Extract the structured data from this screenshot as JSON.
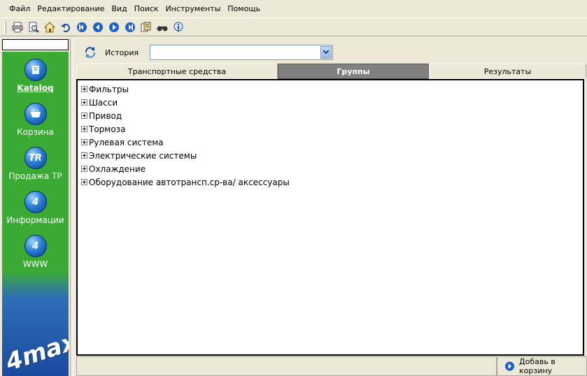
{
  "menu": [
    "Файл",
    "Редактирование",
    "Вид",
    "Поиск",
    "Инструменты",
    "Помощь"
  ],
  "toolbar": {
    "icons": [
      "print-icon",
      "preview-icon",
      "home-icon",
      "undo-icon",
      "first-icon",
      "back-icon",
      "forward-icon",
      "last-icon",
      "documents-icon",
      "binoculars-icon",
      "info-icon"
    ]
  },
  "sidebar": {
    "items": [
      {
        "label": "Kataloq",
        "icon": "catalog-icon",
        "glyph": "",
        "active": true
      },
      {
        "label": "Корзина",
        "icon": "basket-icon",
        "glyph": "",
        "active": false
      },
      {
        "label": "Продажа ТР",
        "icon": "tr-icon",
        "glyph": "TR",
        "active": false
      },
      {
        "label": "Информации",
        "icon": "4max-info-icon",
        "glyph": "4",
        "active": false
      },
      {
        "label": "WWW",
        "icon": "4max-www-icon",
        "glyph": "4",
        "active": false
      }
    ],
    "logo": "4max"
  },
  "history": {
    "label": "История",
    "value": ""
  },
  "tabs": [
    {
      "label": "Транспортные средства",
      "active": false
    },
    {
      "label": "Группы",
      "active": true
    },
    {
      "label": "Результаты",
      "active": false
    }
  ],
  "tree": [
    "Фильтры",
    "Шасси",
    "Привод",
    "Тормоза",
    "Рулевая система",
    "Электрические системы",
    "Охлаждение",
    "Оборудование автотрансп.ср-ва/ аксессуары"
  ],
  "status": {
    "add_to_cart": "Добавь в корзину"
  },
  "colors": {
    "sidebar_green": "#3aaa35",
    "sidebar_blue": "#1a4a9e",
    "active_tab": "#808080"
  }
}
